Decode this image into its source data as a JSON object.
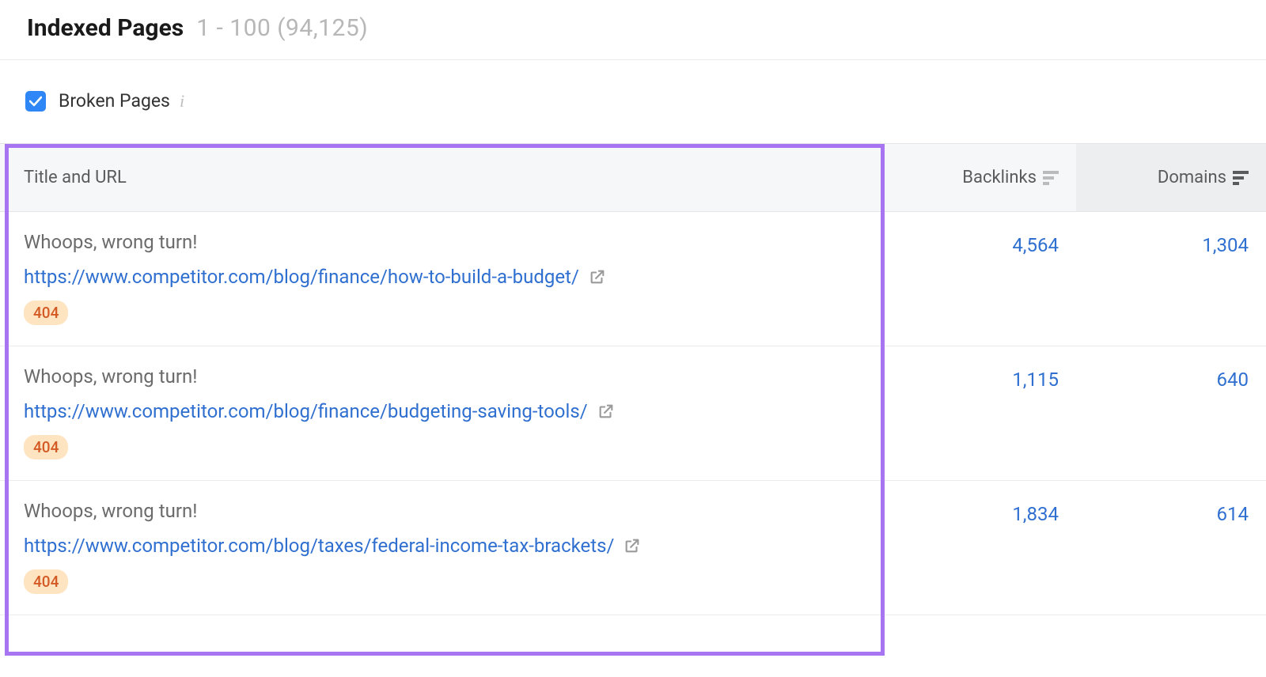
{
  "header": {
    "title": "Indexed Pages",
    "range_count": "1 - 100 (94,125)"
  },
  "filter": {
    "broken_pages_checked": true,
    "broken_pages_label": "Broken Pages"
  },
  "columns": {
    "title_url": "Title and URL",
    "backlinks": "Backlinks",
    "domains": "Domains",
    "sorted_by": "domains"
  },
  "rows": [
    {
      "title": "Whoops, wrong turn!",
      "url": "https://www.competitor.com/blog/finance/how-to-build-a-budget/",
      "status": "404",
      "backlinks": "4,564",
      "domains": "1,304"
    },
    {
      "title": "Whoops, wrong turn!",
      "url": "https://www.competitor.com/blog/finance/budgeting-saving-tools/",
      "status": "404",
      "backlinks": "1,115",
      "domains": "640"
    },
    {
      "title": "Whoops, wrong turn!",
      "url": "https://www.competitor.com/blog/taxes/federal-income-tax-brackets/",
      "status": "404",
      "backlinks": "1,834",
      "domains": "614"
    }
  ]
}
